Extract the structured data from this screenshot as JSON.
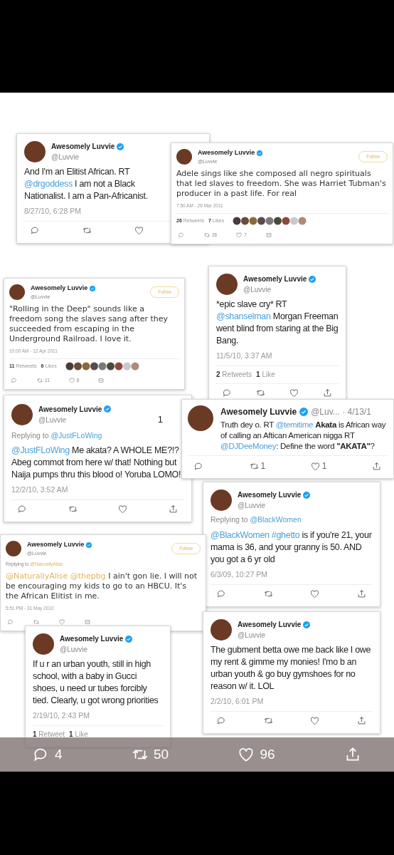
{
  "tweets": [
    {
      "kind": "app",
      "name": "Awesomely Luvvie",
      "handle": "@Luvvie",
      "body": [
        {
          "kind": "text",
          "text": "And I'm an Elitist African. RT "
        },
        {
          "kind": "mention",
          "text": "@drgoddess"
        },
        {
          "kind": "text",
          "text": " I am not a Black Nationalist. I am a Pan-Africanist."
        }
      ],
      "date": "8/27/10, 6:28 PM"
    },
    {
      "kind": "embed",
      "name": "Awesomely Luvvie",
      "handle": "@Luvvie",
      "follow": "Follow",
      "body": [
        {
          "kind": "text",
          "text": "Adele sings like she composed all negro spirituals that led slaves to freedom. She was Harriet Tubman's producer in a past life. For real"
        }
      ],
      "date": "7:50 AM - 26 Mar 2011",
      "stats": [
        {
          "count": "26",
          "label": "Retweets"
        },
        {
          "count": "7",
          "label": "Likes"
        }
      ],
      "retweet_count": "26",
      "like_count": "7"
    },
    {
      "kind": "embed",
      "name": "Awesomely Luvvie",
      "handle": "@Luvvie",
      "follow": "Follow",
      "body": [
        {
          "kind": "text",
          "text": "\"Rolling in the Deep\" sounds like a freedom song the slaves sang after they succeeded from escaping in the Underground Railroad. I love it."
        }
      ],
      "date": "10:00 AM - 12 Apr 2011",
      "stats": [
        {
          "count": "11",
          "label": "Retweets"
        },
        {
          "count": "6",
          "label": "Likes"
        }
      ],
      "retweet_count": "11",
      "like_count": "6"
    },
    {
      "kind": "app",
      "name": "Awesomely Luvvie",
      "handle": "@Luvvie",
      "body": [
        {
          "kind": "text",
          "text": "*epic slave cry* RT "
        },
        {
          "kind": "mention",
          "text": "@shanselman"
        },
        {
          "kind": "text",
          "text": " Morgan Freeman went blind from staring at the Big Bang."
        }
      ],
      "date": "11/5/10, 3:37 AM",
      "stats": [
        {
          "count": "2",
          "label": "Retweets"
        },
        {
          "count": "1",
          "label": "Like"
        }
      ]
    },
    {
      "kind": "app",
      "name": "Awesomely Luvvie",
      "handle": "@Luvvie",
      "marker": "1",
      "reply_to": {
        "label": "Replying to",
        "handle": "@JustFLoWing"
      },
      "body": [
        {
          "kind": "mention",
          "text": "@JustFLoWing"
        },
        {
          "kind": "text",
          "text": " Me akata? A WHOLE ME?!? Abeg commot from here w/ that! Nothing but Naija pumps thru this blood o! Yoruba LOMO!"
        }
      ],
      "date": "12/2/10, 3:52 AM"
    },
    {
      "kind": "inline",
      "name": "Awesomely Luvvie",
      "handle": "@Luv... · 4/13/1",
      "body": [
        {
          "kind": "text",
          "text": "Truth dey o. RT "
        },
        {
          "kind": "mention",
          "text": "@temitime"
        },
        {
          "kind": "bold",
          "text": "Akata"
        },
        {
          "kind": "text",
          "text": " is African way of calling an Aftican American nigga RT "
        },
        {
          "kind": "mention",
          "text": "@DJDeeMoney"
        },
        {
          "kind": "text",
          "text": ": Define the word "
        },
        {
          "kind": "bold",
          "text": "\"AKATA\""
        },
        {
          "kind": "text",
          "text": "?"
        }
      ],
      "retweet_count": "1",
      "like_count": "1"
    },
    {
      "kind": "app",
      "name": "Awesomely Luvvie",
      "handle": "@Luvvie",
      "reply_to": {
        "label": "Replying to",
        "handle": "@BlackWomen"
      },
      "body": [
        {
          "kind": "mention",
          "text": "@BlackWomen"
        },
        {
          "kind": "mention",
          "text": "#ghetto"
        },
        {
          "kind": "text",
          "text": " is if you're 21, your mama is 36, and your granny is 50. AND you got a 6 yr old"
        }
      ],
      "date": "6/3/09, 10:27 PM"
    },
    {
      "kind": "embed",
      "name": "Awesomely Luvvie",
      "handle": "@Luvvie",
      "follow": "Follow",
      "reply_to": {
        "label": "Replying to",
        "handle": "@NaturallyAlise"
      },
      "body": [
        {
          "kind": "mention",
          "text": "@NaturallyAlise"
        },
        {
          "kind": "mention",
          "text": "@thepbg"
        },
        {
          "kind": "text",
          "text": " I ain't gon lie. I will not be encouraging my kids to go to an HBCU. It's the African Elitist in me."
        }
      ],
      "date": "5:51 PM - 31 May 2010"
    },
    {
      "kind": "app",
      "name": "Awesomely Luvvie",
      "handle": "@Luvvie",
      "body": [
        {
          "kind": "text",
          "text": "If u r an urban youth, still in high school, with a baby in Gucci shoes, u need ur tubes forcibly tied. Clearly, u got wrong priorities"
        }
      ],
      "date": "2/19/10, 2:43 PM",
      "stats": [
        {
          "count": "1",
          "label": "Retweet"
        },
        {
          "count": "1",
          "label": "Like"
        }
      ]
    },
    {
      "kind": "app",
      "name": "Awesomely Luvvie",
      "handle": "@Luvvie",
      "body": [
        {
          "kind": "text",
          "text": "The gubment betta owe me back like I owe my rent & gimme my monies! I'mo b an urban youth & go buy gymshoes for no reason w/ it. LOL"
        }
      ],
      "date": "2/2/10, 6:01 PM"
    }
  ],
  "action_bar": {
    "replies": "4",
    "retweets": "50",
    "likes": "96"
  }
}
